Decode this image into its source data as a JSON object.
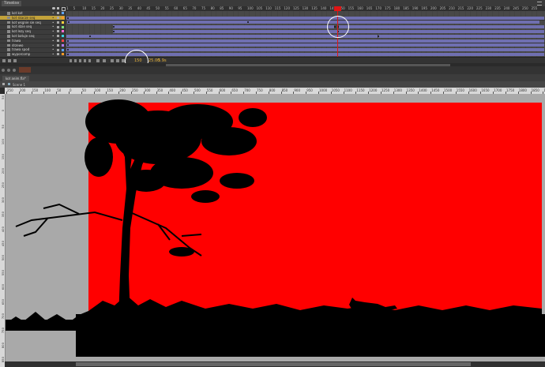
{
  "timeline": {
    "tab_label": "Timeline",
    "layers": [
      {
        "name": "kot kot",
        "selected": false,
        "color": "#5fa5ff"
      },
      {
        "name": "kot skacze seq",
        "selected": true,
        "color": "#ff9a26"
      },
      {
        "name": "kot wsgnie sie seq",
        "selected": false,
        "color": "#ffd23c"
      },
      {
        "name": "kot idzie seq",
        "selected": false,
        "color": "#7fe07f"
      },
      {
        "name": "kot lezy seq",
        "selected": false,
        "color": "#ff6ad5"
      },
      {
        "name": "kot batuje seq",
        "selected": false,
        "color": "#39d4e0"
      },
      {
        "name": "trawa",
        "selected": false,
        "color": "#ff4444"
      },
      {
        "name": "drzewo",
        "selected": false,
        "color": "#b07cff"
      },
      {
        "name": "trawa spod",
        "selected": false,
        "color": "#5fa5ff"
      },
      {
        "name": "wyporcomp",
        "selected": false,
        "color": "#ff9a26"
      }
    ],
    "frame_numbers": [
      "1",
      "5",
      "10",
      "15",
      "20",
      "25",
      "30",
      "35",
      "40",
      "45",
      "50",
      "55",
      "60",
      "65",
      "70",
      "75",
      "80",
      "85",
      "90",
      "95",
      "100",
      "105",
      "110",
      "115",
      "120",
      "125",
      "130",
      "135",
      "140",
      "145",
      "150",
      "155",
      "160",
      "165",
      "170",
      "175",
      "180",
      "185",
      "190",
      "195",
      "200",
      "205",
      "210",
      "215",
      "220",
      "225",
      "230",
      "235",
      "240",
      "245",
      "250",
      "255"
    ],
    "current_frame": "150",
    "fps": "25.00",
    "time": "5.9s"
  },
  "document": {
    "tab_label": "kot anim.fla*",
    "scene_label": "Scene 1"
  },
  "ruler": {
    "h_labels": [
      "250",
      "200",
      "150",
      "100",
      "50",
      "0",
      "50",
      "100",
      "150",
      "200",
      "250",
      "300",
      "350",
      "400",
      "450",
      "500",
      "550",
      "600",
      "650",
      "700",
      "750",
      "800",
      "850",
      "900",
      "950",
      "1000",
      "1050",
      "1100",
      "1150",
      "1200",
      "1250",
      "1300",
      "1350",
      "1400",
      "1450",
      "1500",
      "1550",
      "1600",
      "1650",
      "1700",
      "1750",
      "1800",
      "1850",
      "1900"
    ],
    "v_labels": [
      "50",
      "0",
      "50",
      "100",
      "150",
      "200",
      "250",
      "300",
      "350",
      "400",
      "450",
      "500",
      "550",
      "600",
      "650",
      "700",
      "750",
      "800",
      "850"
    ]
  },
  "colors": {
    "stage_background": "#ff0000",
    "silhouette": "#000000",
    "selected_layer": "#c3a23a",
    "tween_span": "#6f6fb0",
    "playhead": "#e01515"
  }
}
